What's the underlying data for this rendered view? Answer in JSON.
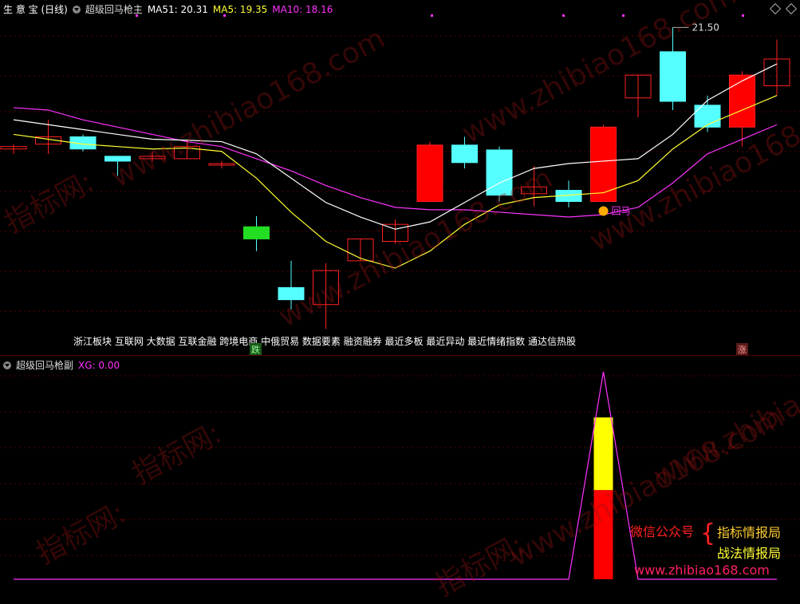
{
  "colors": {
    "ma51": "#ffffff",
    "ma5": "#ffff33",
    "ma10": "#ff33ff",
    "up": "#ff2020",
    "down": "#55ffff",
    "red_fill": "#ff0000",
    "yellow_fill": "#ffff00",
    "xg_line": "#ff33ff",
    "grid": "#5a0000"
  },
  "main_header": {
    "app": "生 意 宝 (日线)",
    "indicator": "超级回马枪主",
    "ma51_label": "MA51: 20.31",
    "ma5_label": "MA5: 19.35",
    "ma10_label": "MA10: 18.16"
  },
  "high_label": "21.50",
  "signal_label": "回马",
  "sector_tags": "浙江板块 互联网 大数据 互联金融 跨境电商 中俄贸易 数据要素 融资融券 最近多板 最近异动 最近情绪指数 通达信热股",
  "badge_fall": "跌",
  "badge_rise": "涨",
  "sub_header": {
    "indicator": "超级回马枪副",
    "xg_label": "XG: 0.00"
  },
  "promo": {
    "wechat": "微信公众号",
    "brace": "{",
    "name1": "指标情报局",
    "name2": "战法情报局",
    "url": "www.zhibiao168.com"
  },
  "watermarks": [
    "www.zhibiao168.com",
    "www.zhibiao168.com",
    "指标网:",
    "www.zhibiao168.com",
    "www.zhibiao168.com",
    "指标网:",
    "指标网:",
    "www.zhibiao168.com",
    "www.zhibiao168.com",
    "指标网:"
  ],
  "candles": [
    {
      "o": 19.0,
      "h": 19.1,
      "l": 18.9,
      "c": 19.05
    },
    {
      "o": 19.1,
      "h": 19.6,
      "l": 18.9,
      "c": 19.25
    },
    {
      "o": 19.25,
      "h": 19.3,
      "l": 18.95,
      "c": 19.0
    },
    {
      "o": 18.85,
      "h": 18.85,
      "l": 18.45,
      "c": 18.75
    },
    {
      "o": 18.8,
      "h": 18.95,
      "l": 18.75,
      "c": 18.85
    },
    {
      "o": 18.8,
      "h": 19.2,
      "l": 18.8,
      "c": 19.05
    },
    {
      "o": 18.7,
      "h": 18.75,
      "l": 18.6,
      "c": 18.7
    },
    {
      "o": 17.4,
      "h": 17.62,
      "l": 16.9,
      "c": 17.15
    },
    {
      "o": 16.15,
      "h": 16.7,
      "l": 15.7,
      "c": 15.9
    },
    {
      "o": 15.8,
      "h": 16.65,
      "l": 15.3,
      "c": 16.5
    },
    {
      "o": 16.7,
      "h": 17.15,
      "l": 16.7,
      "c": 17.15
    },
    {
      "o": 17.1,
      "h": 17.55,
      "l": 17.05,
      "c": 17.45
    },
    {
      "o": 17.92,
      "h": 19.15,
      "l": 17.92,
      "c": 19.08
    },
    {
      "o": 19.08,
      "h": 19.25,
      "l": 18.6,
      "c": 18.72
    },
    {
      "o": 18.98,
      "h": 19.05,
      "l": 17.92,
      "c": 18.05
    },
    {
      "o": 18.08,
      "h": 18.65,
      "l": 17.82,
      "c": 18.22
    },
    {
      "o": 18.15,
      "h": 18.35,
      "l": 17.8,
      "c": 17.92
    },
    {
      "o": 17.92,
      "h": 19.5,
      "l": 17.92,
      "c": 19.45
    },
    {
      "o": 20.05,
      "h": 20.52,
      "l": 19.65,
      "c": 20.52
    },
    {
      "o": 21.0,
      "h": 21.5,
      "l": 19.8,
      "c": 19.98
    },
    {
      "o": 19.9,
      "h": 20.1,
      "l": 19.35,
      "c": 19.45
    },
    {
      "o": 19.45,
      "h": 20.6,
      "l": 19.05,
      "c": 20.52
    },
    {
      "o": 20.3,
      "h": 21.25,
      "l": 20.1,
      "c": 20.85
    }
  ],
  "ma51_series": [
    19.6,
    19.5,
    19.4,
    19.3,
    19.2,
    19.18,
    19.15,
    18.9,
    18.4,
    17.9,
    17.6,
    17.35,
    17.5,
    17.9,
    18.3,
    18.6,
    18.7,
    18.75,
    18.8,
    19.3,
    20.0,
    20.4,
    20.75
  ],
  "ma5_series": [
    19.3,
    19.2,
    19.1,
    19.05,
    19.0,
    19.02,
    18.95,
    18.4,
    17.7,
    17.1,
    16.75,
    16.55,
    16.9,
    17.45,
    17.85,
    18.0,
    18.05,
    18.1,
    18.35,
    19.0,
    19.5,
    19.8,
    20.1
  ],
  "ma10_series": [
    19.85,
    19.8,
    19.6,
    19.45,
    19.3,
    19.15,
    19.05,
    18.8,
    18.55,
    18.25,
    18.0,
    17.8,
    17.75,
    17.75,
    17.7,
    17.65,
    17.6,
    17.65,
    17.8,
    18.3,
    18.9,
    19.2,
    19.5
  ],
  "xg_series": [
    0,
    0,
    0,
    0,
    0,
    0,
    0,
    0,
    0,
    0,
    0,
    0,
    0,
    0,
    0,
    0,
    0,
    1,
    0,
    0,
    0,
    0,
    0
  ],
  "sub_bar": {
    "index": 17,
    "red_level": 0.43,
    "yellow_level": 0.78
  }
}
